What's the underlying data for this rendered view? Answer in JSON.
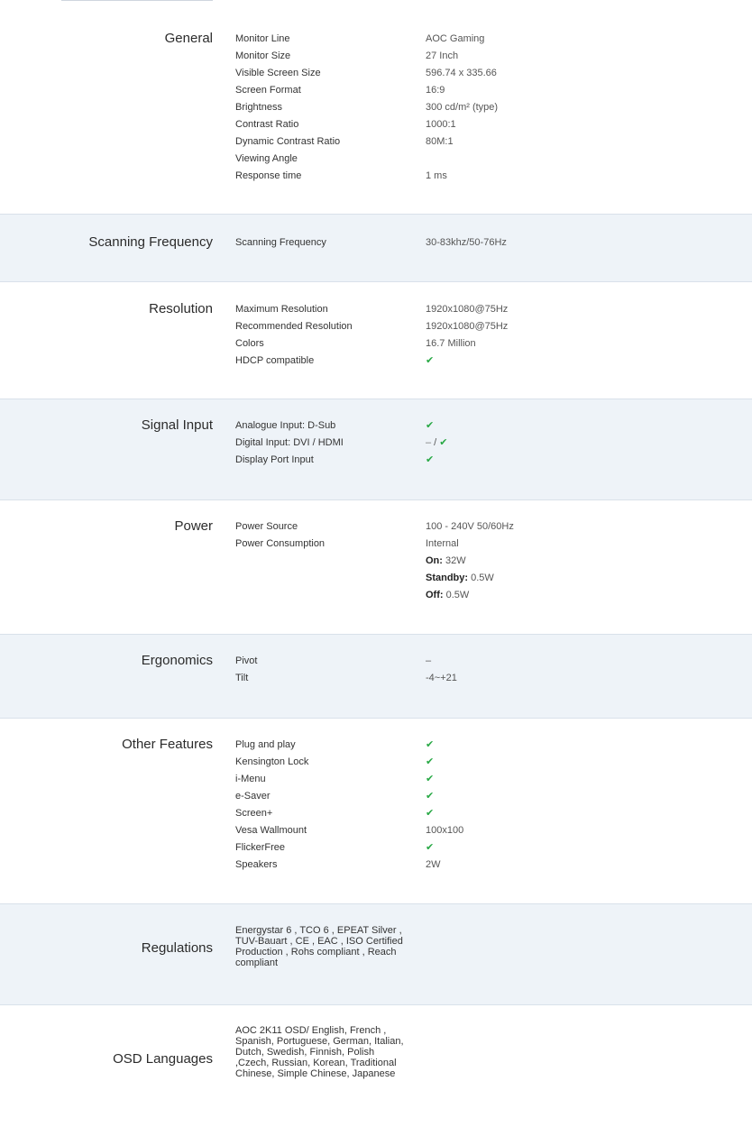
{
  "check_glyph": "✔",
  "check_color": "#27a844",
  "sections": {
    "general": {
      "title": "General",
      "rows": [
        {
          "label": "Monitor Line",
          "value": "AOC Gaming"
        },
        {
          "label": "Monitor Size",
          "value": "27 Inch"
        },
        {
          "label": "Visible Screen Size",
          "value": "596.74 x 335.66"
        },
        {
          "label": "Screen Format",
          "value": "16:9"
        },
        {
          "label": "Brightness",
          "value": "300 cd/m² (type)"
        },
        {
          "label": "Contrast Ratio",
          "value": "1000:1"
        },
        {
          "label": "Dynamic Contrast Ratio",
          "value": "80M:1"
        },
        {
          "label": "Viewing Angle",
          "value": ""
        },
        {
          "label": "Response time",
          "value": "1 ms"
        }
      ]
    },
    "scanning": {
      "title": "Scanning Frequency",
      "rows": [
        {
          "label": "Scanning Frequency",
          "value": "30-83khz/50-76Hz"
        }
      ]
    },
    "resolution": {
      "title": "Resolution",
      "rows": [
        {
          "label": "Maximum Resolution",
          "value": "1920x1080@75Hz"
        },
        {
          "label": "Recommended Resolution",
          "value": "1920x1080@75Hz"
        },
        {
          "label": "Colors",
          "value": "16.7 Million"
        },
        {
          "label": "HDCP compatible",
          "value": "✔"
        }
      ]
    },
    "signal": {
      "title": "Signal Input",
      "rows": [
        {
          "label": "Analogue Input: D-Sub",
          "value": "✔"
        },
        {
          "label": "Digital Input: DVI / HDMI",
          "value_a": "–",
          "value_sep": " / ",
          "value_b": "✔"
        },
        {
          "label": "Display Port Input",
          "value": "✔"
        }
      ]
    },
    "power": {
      "title": "Power",
      "rows": [
        {
          "label": "Power Source",
          "value": "100 - 240V 50/60Hz"
        },
        {
          "label": "Power Consumption",
          "value": "Internal"
        }
      ],
      "consumption": [
        {
          "key": "On:",
          "value": " 32W"
        },
        {
          "key": "Standby:",
          "value": " 0.5W"
        },
        {
          "key": "Off:",
          "value": " 0.5W"
        }
      ]
    },
    "ergonomics": {
      "title": "Ergonomics",
      "rows": [
        {
          "label": "Pivot",
          "value": "–"
        },
        {
          "label": "Tilt",
          "value": "-4~+21"
        }
      ]
    },
    "other": {
      "title": "Other Features",
      "rows": [
        {
          "label": "Plug and play",
          "value": "✔"
        },
        {
          "label": "Kensington Lock",
          "value": "✔"
        },
        {
          "label": "i-Menu",
          "value": "✔"
        },
        {
          "label": "e-Saver",
          "value": "✔"
        },
        {
          "label": "Screen+",
          "value": "✔"
        },
        {
          "label": "Vesa Wallmount",
          "value": "100x100"
        },
        {
          "label": "FlickerFree",
          "value": "✔"
        },
        {
          "label": "Speakers",
          "value": "2W"
        }
      ]
    },
    "regulations": {
      "title": "Regulations",
      "text": "Energystar 6 , TCO 6 , EPEAT Silver , TUV-Bauart , CE , EAC , ISO Certified Production , Rohs compliant , Reach compliant"
    },
    "osd": {
      "title": "OSD Languages",
      "text": "AOC 2K11 OSD/ English, French , Spanish, Portuguese, German, Italian, Dutch, Swedish, Finnish, Polish ,Czech, Russian, Korean, Traditional Chinese, Simple Chinese, Japanese"
    }
  }
}
